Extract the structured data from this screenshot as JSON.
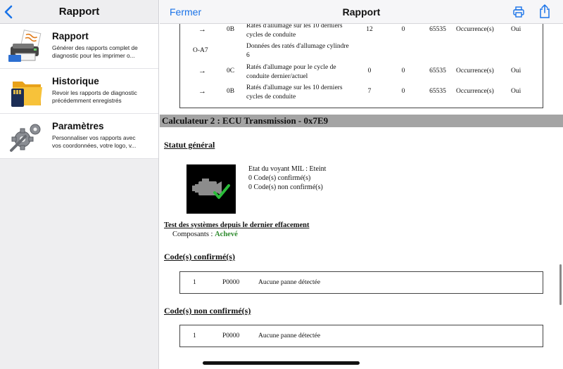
{
  "sidebar": {
    "title": "Rapport",
    "items": [
      {
        "icon": "printer-report-icon",
        "title": "Rapport",
        "desc": "Générer des rapports complet de\ndiagnostic pour les imprimer o..."
      },
      {
        "icon": "folder-sd-card-icon",
        "title": "Historique",
        "desc": "Revoir les rapports de diagnostic\nprécédemment enregistrés"
      },
      {
        "icon": "settings-gears-icon",
        "title": "Paramètres",
        "desc": "Personnaliser vos rapports avec\nvos coordonnées, votre logo, v..."
      }
    ]
  },
  "header": {
    "close_label": "Fermer",
    "title": "Rapport"
  },
  "fault_rows": [
    {
      "arrow": "→",
      "code": "0B",
      "desc": "Ratés d'allumage sur les 10 derniers cycles de conduite",
      "v1": "12",
      "v2": "0",
      "v3": "65535",
      "unit": "Occurrence(s)",
      "flag": "Oui"
    },
    {
      "pid": "O-A7",
      "desc": "Données des ratés d'allumage cylindre 6"
    },
    {
      "arrow": "→",
      "code": "0C",
      "desc": "Ratés d'allumage pour le cycle de conduite dernier/actuel",
      "v1": "0",
      "v2": "0",
      "v3": "65535",
      "unit": "Occurrence(s)",
      "flag": "Oui"
    },
    {
      "arrow": "→",
      "code": "0B",
      "desc": "Ratés d'allumage sur les 10 derniers cycles de conduite",
      "v1": "7",
      "v2": "0",
      "v3": "65535",
      "unit": "Occurrence(s)",
      "flag": "Oui"
    }
  ],
  "ecu": {
    "title": "Calculateur 2 : ECU Transmission - 0x7E9",
    "status_heading": "Statut général",
    "mil_status": "Etat du voyant MIL : Eteint",
    "confirmed_count": "0 Code(s) confirmé(s)",
    "unconfirmed_count": "0 Code(s) non confirmé(s)",
    "tests_heading": "Test des systèmes depuis le dernier effacement",
    "components_label": "Composants :",
    "components_status": "Achevé",
    "confirmed_heading": "Code(s) confirmé(s)",
    "confirmed_codes": [
      {
        "index": "1",
        "code": "P0000",
        "desc": "Aucune panne détectée"
      }
    ],
    "unconfirmed_heading": "Code(s) non confirmé(s)",
    "unconfirmed_codes": [
      {
        "index": "1",
        "code": "P0000",
        "desc": "Aucune panne détectée"
      }
    ]
  },
  "colors": {
    "accent": "#1a73e8",
    "section_bar": "#a4a4a4",
    "ok_green": "#2e8b2e"
  }
}
